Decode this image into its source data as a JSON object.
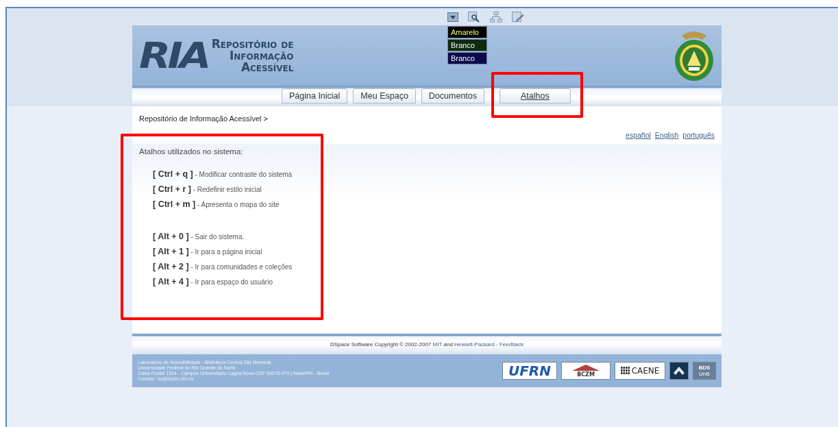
{
  "toolbar_icons": [
    {
      "kind": "dropdown"
    },
    {
      "kind": "magnifier"
    },
    {
      "kind": "sitemap"
    },
    {
      "kind": "edit"
    }
  ],
  "header": {
    "logo": {
      "mark": "RIA",
      "title_lines": [
        "Repositório de",
        "Informação",
        "Acessível"
      ]
    },
    "contrast_options": [
      {
        "label": "Amarelo",
        "color": "#000000",
        "kind": "accent"
      },
      {
        "label": "Branco",
        "color": "#0d2a0d",
        "kind": "plain"
      },
      {
        "label": "Branco",
        "color": "#0b0b4a",
        "kind": "plain"
      }
    ]
  },
  "tabs": [
    {
      "label": "Página Inicial",
      "selected": false,
      "highlighted": false
    },
    {
      "label": "Meu Espaço",
      "selected": false,
      "highlighted": false
    },
    {
      "label": "Documentos",
      "selected": false,
      "highlighted": false
    },
    {
      "label": "Atalhos",
      "selected": true,
      "highlighted": true
    }
  ],
  "breadcrumb": "Repositório de Informação Acessível >",
  "languages": [
    "español",
    "English",
    "português"
  ],
  "shortcuts": {
    "title": "Atalhos utilizados no sistema:",
    "highlighted": true,
    "groups": [
      [
        {
          "key": "[ Ctrl + q ]",
          "description": "- Modificar contraste do sistema"
        },
        {
          "key": "[ Ctrl + r ]",
          "description": "- Redefinir estilo inicial"
        },
        {
          "key": "[ Ctrl + m ]",
          "description": "- Apresenta o mapa do site"
        }
      ],
      [
        {
          "key": "[ Alt + 0 ]",
          "description": "- Sair do sistema."
        },
        {
          "key": "[ Alt + 1 ]",
          "description": "- Ir para a página inicial"
        },
        {
          "key": "[ Alt + 2 ]",
          "description": "- Ir para comunidades e coleções"
        },
        {
          "key": "[ Alt + 4 ]",
          "description": "- Ir para espaço do usuário"
        }
      ]
    ]
  },
  "footer": {
    "copyright": [
      "DSpace Software Copyright © 2002-2007 ",
      "MIT",
      " and ",
      "Hewlett-Packard",
      " - ",
      "Feedback"
    ],
    "contact_lines": [
      "Laboratório de Acessibilidade - Biblioteca Central Zila Mamede",
      "Universidade Federal do Rio Grande do Norte",
      "Caixa Postal 1524 - Campus Universitário Lagoa Nova CEP 59078-970 | Natal/RN - Brasil",
      "Contato: ria@bczm.ufrn.br"
    ],
    "logos": [
      {
        "kind": "ufrn",
        "text": "UFRN"
      },
      {
        "kind": "bczm",
        "text": "BCZM"
      },
      {
        "kind": "caene",
        "text": "CAENE"
      },
      {
        "kind": "arrow"
      },
      {
        "kind": "bds",
        "text": "BDS",
        "subtext": "UnB"
      }
    ]
  }
}
